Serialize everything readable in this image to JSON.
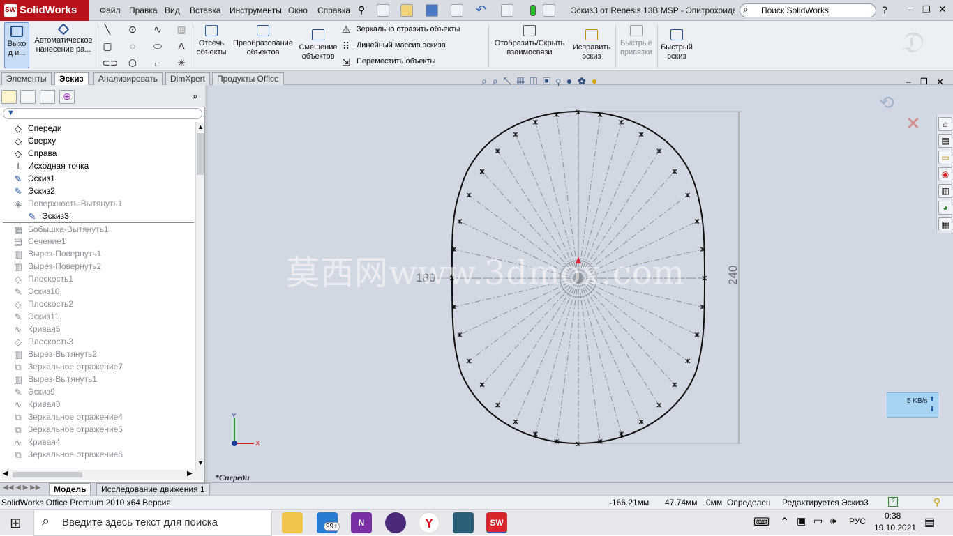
{
  "app": {
    "name": "SolidWorks",
    "doc_title": "Эскиз3 от Renesis 13B MSP - Эпитрохоидая ...",
    "search_placeholder": "Поиск SolidWorks"
  },
  "menu": [
    "Файл",
    "Правка",
    "Вид",
    "Вставка",
    "Инструменты",
    "Окно",
    "Справка"
  ],
  "command_manager": {
    "exit": "Выхо\nд и...",
    "auto_dim": "Автоматическое\nнанесение ра...",
    "trim": "Отсечь\nобъекты",
    "convert": "Преобразование\nобъектов",
    "offset": "Смещение\nобъектов",
    "mirror": "Зеркально отразить объекты",
    "linear_pattern": "Линейный массив эскиза",
    "move": "Переместить объекты",
    "show_relations": "Отобразить/Скрыть\nвзаимосвязи",
    "repair": "Исправить\nэскиз",
    "quick_snaps": "Быстрые\nпривязки",
    "rapid_sketch": "Быстрый\nэскиз"
  },
  "tabs": [
    "Элементы",
    "Эскиз",
    "Анализировать",
    "DimXpert",
    "Продукты Office"
  ],
  "active_tab": "Эскиз",
  "tree": [
    {
      "label": "Спереди",
      "icon": "plane-icon",
      "state": "normal"
    },
    {
      "label": "Сверху",
      "icon": "plane-icon",
      "state": "normal"
    },
    {
      "label": "Справа",
      "icon": "plane-icon",
      "state": "normal"
    },
    {
      "label": "Исходная точка",
      "icon": "origin-icon",
      "state": "normal"
    },
    {
      "label": "Эскиз1",
      "icon": "sketch-icon",
      "state": "normal"
    },
    {
      "label": "Эскиз2",
      "icon": "sketch-icon",
      "state": "normal"
    },
    {
      "label": "Поверхность-Вытянуть1",
      "icon": "surface-icon",
      "state": "gray"
    },
    {
      "label": "Эскиз3",
      "icon": "sketch-icon",
      "state": "child"
    },
    {
      "label": "Бобышка-Вытянуть1",
      "icon": "boss-icon",
      "state": "gray"
    },
    {
      "label": "Сечение1",
      "icon": "section-icon",
      "state": "gray"
    },
    {
      "label": "Вырез-Повернуть1",
      "icon": "cut-icon",
      "state": "gray"
    },
    {
      "label": "Вырез-Повернуть2",
      "icon": "cut-icon",
      "state": "gray"
    },
    {
      "label": "Плоскость1",
      "icon": "plane-icon",
      "state": "gray"
    },
    {
      "label": "Эскиз10",
      "icon": "sketch-icon",
      "state": "gray"
    },
    {
      "label": "Плоскость2",
      "icon": "plane-icon",
      "state": "gray"
    },
    {
      "label": "Эскиз11",
      "icon": "sketch-icon",
      "state": "gray"
    },
    {
      "label": "Кривая5",
      "icon": "curve-icon",
      "state": "gray"
    },
    {
      "label": "Плоскость3",
      "icon": "plane-icon",
      "state": "gray"
    },
    {
      "label": "Вырез-Вытянуть2",
      "icon": "cut-icon",
      "state": "gray"
    },
    {
      "label": "Зеркальное отражение7",
      "icon": "mirror-icon",
      "state": "gray"
    },
    {
      "label": "Вырез-Вытянуть1",
      "icon": "cut-icon",
      "state": "gray"
    },
    {
      "label": "Эскиз9",
      "icon": "sketch-icon",
      "state": "gray"
    },
    {
      "label": "Кривая3",
      "icon": "curve-icon",
      "state": "gray"
    },
    {
      "label": "Зеркальное отражение4",
      "icon": "mirror-icon",
      "state": "gray"
    },
    {
      "label": "Зеркальное отражение5",
      "icon": "mirror-icon",
      "state": "gray"
    },
    {
      "label": "Кривая4",
      "icon": "curve-icon",
      "state": "gray"
    },
    {
      "label": "Зеркальное отражение6",
      "icon": "mirror-icon",
      "state": "gray"
    }
  ],
  "viewport": {
    "view_name": "*Спереди",
    "dim_width": "180",
    "dim_height": "240",
    "axis_x": "X",
    "axis_y": "Y",
    "watermark": "莫西网www.3dmox.com"
  },
  "bottom_tabs": [
    "Модель",
    "Исследование движения 1"
  ],
  "status": {
    "product": "SolidWorks Office Premium 2010 x64 Версия",
    "x": "-166.21мм",
    "y": "47.74мм",
    "z": "0мм",
    "state": "Определен",
    "editing": "Редактируется Эскиз3"
  },
  "net_meter": {
    "speed": "5 KB/s"
  },
  "taskbar": {
    "search": "Введите здесь текст для поиска",
    "badge": "99+",
    "lang": "РУС",
    "time": "0:38",
    "date": "19.10.2021"
  }
}
